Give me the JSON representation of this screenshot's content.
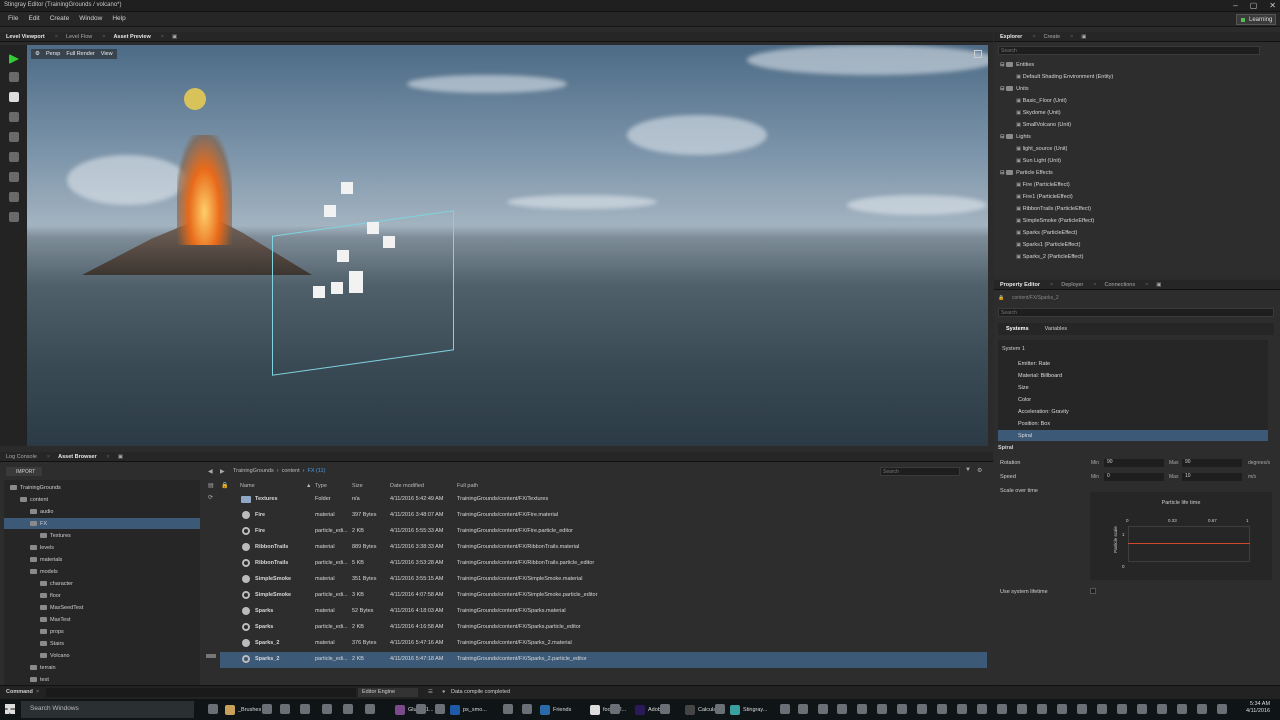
{
  "window": {
    "title": "Stingray Editor (TrainingGrounds / volcano*)",
    "controls": [
      "–",
      "▢",
      "✕"
    ]
  },
  "menu": {
    "items": [
      "File",
      "Edit",
      "Create",
      "Window",
      "Help"
    ],
    "learning": "Learning"
  },
  "viewport_tabs": [
    "Level Viewport",
    "Level Flow",
    "Asset Preview"
  ],
  "viewport": {
    "modes": [
      "Persp",
      "Full Render",
      "View"
    ]
  },
  "explorer": {
    "tabs": [
      "Explorer",
      "Create"
    ],
    "search_placeholder": "Search",
    "groups": [
      {
        "label": "Entities",
        "items": [
          "Default Shading Environment (Entity)"
        ]
      },
      {
        "label": "Units",
        "items": [
          "Basic_Floor (Unit)",
          "Skydome (Unit)",
          "SmallVolcano (Unit)"
        ]
      },
      {
        "label": "Lights",
        "items": [
          "light_source (Unit)",
          "Sun Light (Unit)"
        ]
      },
      {
        "label": "Particle Effects",
        "items": [
          "Fire (ParticleEffect)",
          "Fire1 (ParticleEffect)",
          "RibbonTrails (ParticleEffect)",
          "SimpleSmoke (ParticleEffect)",
          "Sparks (ParticleEffect)",
          "Sparks1 (ParticleEffect)",
          "Sparks_2 (ParticleEffect)"
        ]
      }
    ]
  },
  "property_editor": {
    "tabs": [
      "Property Editor",
      "Deployer",
      "Connections"
    ],
    "path": "content/FX/Sparks_2",
    "search_placeholder": "Search",
    "subtabs": [
      "Systems",
      "Variables"
    ],
    "system": "System 1",
    "modules": [
      "Emitter: Rate",
      "Material: Billboard",
      "Size",
      "Color",
      "Acceleration: Gravity",
      "Position: Box",
      "Spiral"
    ],
    "spiral": {
      "header": "Spiral",
      "rotation_label": "Rotation",
      "speed_label": "Speed",
      "min_label": "Min",
      "max_label": "Max",
      "rotation_min": "90",
      "rotation_max": "90",
      "rotation_unit": "degrees/s",
      "speed_min": "0",
      "speed_max": "10",
      "speed_unit": "m/s",
      "scale_label": "Scale over time",
      "graph_title": "Particle life time",
      "graph_ylabel": "Particle scale",
      "graph_ticks": [
        "0",
        "0.33",
        "0.67",
        "1"
      ],
      "graph_y_ticks": [
        "1",
        "0"
      ],
      "lifetime_label": "Use system lifetime"
    }
  },
  "bottom_tabs": [
    "Log Console",
    "Asset Browser"
  ],
  "asset_browser": {
    "import_label": "IMPORT",
    "breadcrumb": [
      "TrainingGrounds",
      "content",
      "FX (11)"
    ],
    "search_placeholder": "Search",
    "tree": [
      {
        "label": "TrainingGrounds",
        "depth": 0
      },
      {
        "label": "content",
        "depth": 1
      },
      {
        "label": "audio",
        "depth": 2
      },
      {
        "label": "FX",
        "depth": 2
      },
      {
        "label": "Textures",
        "depth": 3
      },
      {
        "label": "levels",
        "depth": 2
      },
      {
        "label": "materials",
        "depth": 2
      },
      {
        "label": "models",
        "depth": 2
      },
      {
        "label": "character",
        "depth": 3
      },
      {
        "label": "floor",
        "depth": 3
      },
      {
        "label": "MaxSeedTest",
        "depth": 3
      },
      {
        "label": "MaxTest",
        "depth": 3
      },
      {
        "label": "props",
        "depth": 3
      },
      {
        "label": "Stairs",
        "depth": 3
      },
      {
        "label": "Volcano",
        "depth": 3
      },
      {
        "label": "terrain",
        "depth": 2
      },
      {
        "label": "test",
        "depth": 2
      }
    ],
    "columns": [
      "Name",
      "Type",
      "Size",
      "Date modified",
      "Full path"
    ],
    "rows": [
      {
        "name": "Textures",
        "type": "Folder",
        "size": "n/a",
        "date": "4/11/2016 5:42:49 AM",
        "path": "TrainingGrounds/content/FX/Textures",
        "icon": "folder"
      },
      {
        "name": "Fire",
        "type": "material",
        "size": "397 Bytes",
        "date": "4/11/2016 3:48:07 AM",
        "path": "TrainingGrounds/content/FX/Fire.material",
        "icon": "material"
      },
      {
        "name": "Fire",
        "type": "particle_edi...",
        "size": "2 KB",
        "date": "4/11/2016 5:55:33 AM",
        "path": "TrainingGrounds/content/FX/Fire.particle_editor",
        "icon": "particle"
      },
      {
        "name": "RibbonTrails",
        "type": "material",
        "size": "889 Bytes",
        "date": "4/11/2016 3:38:33 AM",
        "path": "TrainingGrounds/content/FX/RibbonTrails.material",
        "icon": "material"
      },
      {
        "name": "RibbonTrails",
        "type": "particle_edi...",
        "size": "5 KB",
        "date": "4/11/2016 3:53:28 AM",
        "path": "TrainingGrounds/content/FX/RibbonTrails.particle_editor",
        "icon": "particle"
      },
      {
        "name": "SimpleSmoke",
        "type": "material",
        "size": "351 Bytes",
        "date": "4/11/2016 3:55:15 AM",
        "path": "TrainingGrounds/content/FX/SimpleSmoke.material",
        "icon": "material"
      },
      {
        "name": "SimpleSmoke",
        "type": "particle_edi...",
        "size": "3 KB",
        "date": "4/11/2016 4:07:58 AM",
        "path": "TrainingGrounds/content/FX/SimpleSmoke.particle_editor",
        "icon": "particle"
      },
      {
        "name": "Sparks",
        "type": "material",
        "size": "52 Bytes",
        "date": "4/11/2016 4:18:03 AM",
        "path": "TrainingGrounds/content/FX/Sparks.material",
        "icon": "material"
      },
      {
        "name": "Sparks",
        "type": "particle_edi...",
        "size": "2 KB",
        "date": "4/11/2016 4:16:58 AM",
        "path": "TrainingGrounds/content/FX/Sparks.particle_editor",
        "icon": "particle"
      },
      {
        "name": "Sparks_2",
        "type": "material",
        "size": "376 Bytes",
        "date": "4/11/2016 5:47:16 AM",
        "path": "TrainingGrounds/content/FX/Sparks_2.material",
        "icon": "material"
      },
      {
        "name": "Sparks_2",
        "type": "particle_edi...",
        "size": "2 KB",
        "date": "4/11/2016 5:47:18 AM",
        "path": "TrainingGrounds/content/FX/Sparks_2.particle_editor",
        "icon": "particle"
      }
    ]
  },
  "status": {
    "command_label": "Command",
    "engine": "Editor Engine",
    "message": "Data compile completed"
  },
  "taskbar": {
    "search_placeholder": "Search Windows",
    "apps": [
      "_Brushes",
      "GluaIT 1...",
      "ps_smo...",
      "Friends",
      "foobar2...",
      "Adobe ...",
      "Calculat...",
      "Stingray..."
    ],
    "time": "5:34 AM",
    "date": "4/11/2016"
  }
}
